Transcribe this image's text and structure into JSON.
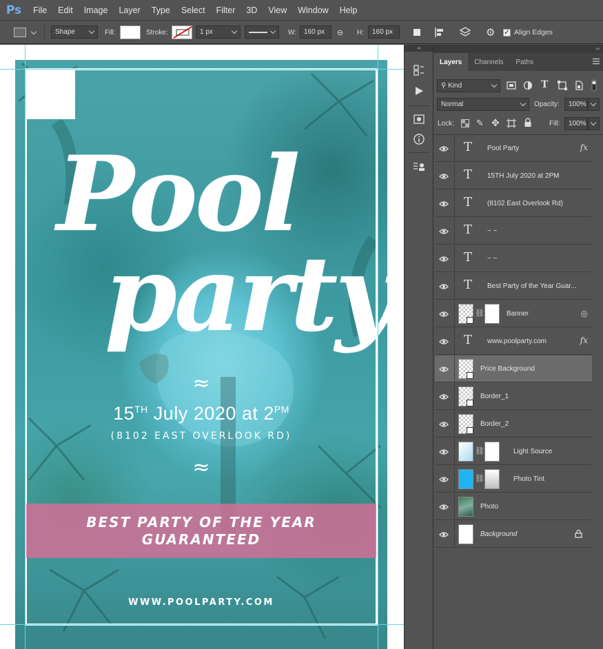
{
  "app": {
    "logo": "Ps"
  },
  "menu": [
    "File",
    "Edit",
    "Image",
    "Layer",
    "Type",
    "Select",
    "Filter",
    "3D",
    "View",
    "Window",
    "Help"
  ],
  "options": {
    "tool_mode": "Shape",
    "fill_label": "Fill:",
    "stroke_label": "Stroke:",
    "stroke_width": "1 px",
    "w_label": "W:",
    "w_value": "160 px",
    "h_label": "H:",
    "h_value": "160 px",
    "align_edges": "Align Edges",
    "align_edges_checked": true
  },
  "poster": {
    "title_line1": "Pool",
    "title_line2": "party",
    "tilde": "≈",
    "date_day": "15",
    "date_suffix": "TH",
    "date_rest": " July 2020 at 2",
    "date_pm": "PM",
    "address": "(8102 EAST OVERLOOK RD)",
    "banner_line1": "BEST PARTY OF THE YEAR",
    "banner_line2": "GUARANTEED",
    "website": "WWW.POOLPARTY.COM",
    "banner_color": "#d86e96"
  },
  "layers_panel": {
    "tabs": [
      "Layers",
      "Channels",
      "Paths"
    ],
    "active_tab": "Layers",
    "filter_kind": "Kind",
    "blend_mode": "Normal",
    "opacity_label": "Opacity:",
    "opacity": "100%",
    "lock_label": "Lock:",
    "fill_label": "Fill:",
    "fill": "100%",
    "layers": [
      {
        "name": "Pool  Party",
        "kind": "text",
        "fx": true
      },
      {
        "name": "15TH July 2020 at 2PM",
        "kind": "text"
      },
      {
        "name": "(8102 East Overlook Rd)",
        "kind": "text"
      },
      {
        "name": "~ ~",
        "kind": "text"
      },
      {
        "name": "~ ~",
        "kind": "text"
      },
      {
        "name": "Best Party of the Year Guar...",
        "kind": "text"
      },
      {
        "name": "Banner",
        "kind": "shape-mask"
      },
      {
        "name": "www.poolparty.com",
        "kind": "text",
        "fx": true
      },
      {
        "name": "Price Background",
        "kind": "shape",
        "selected": true
      },
      {
        "name": "Border_1",
        "kind": "shape"
      },
      {
        "name": "Border_2",
        "kind": "shape"
      },
      {
        "name": "Light Source",
        "kind": "fill-mask"
      },
      {
        "name": "Photo Tint",
        "kind": "fill-mask"
      },
      {
        "name": "Photo",
        "kind": "image"
      },
      {
        "name": "Background",
        "kind": "background",
        "locked": true
      }
    ],
    "fx_label": "fx"
  }
}
